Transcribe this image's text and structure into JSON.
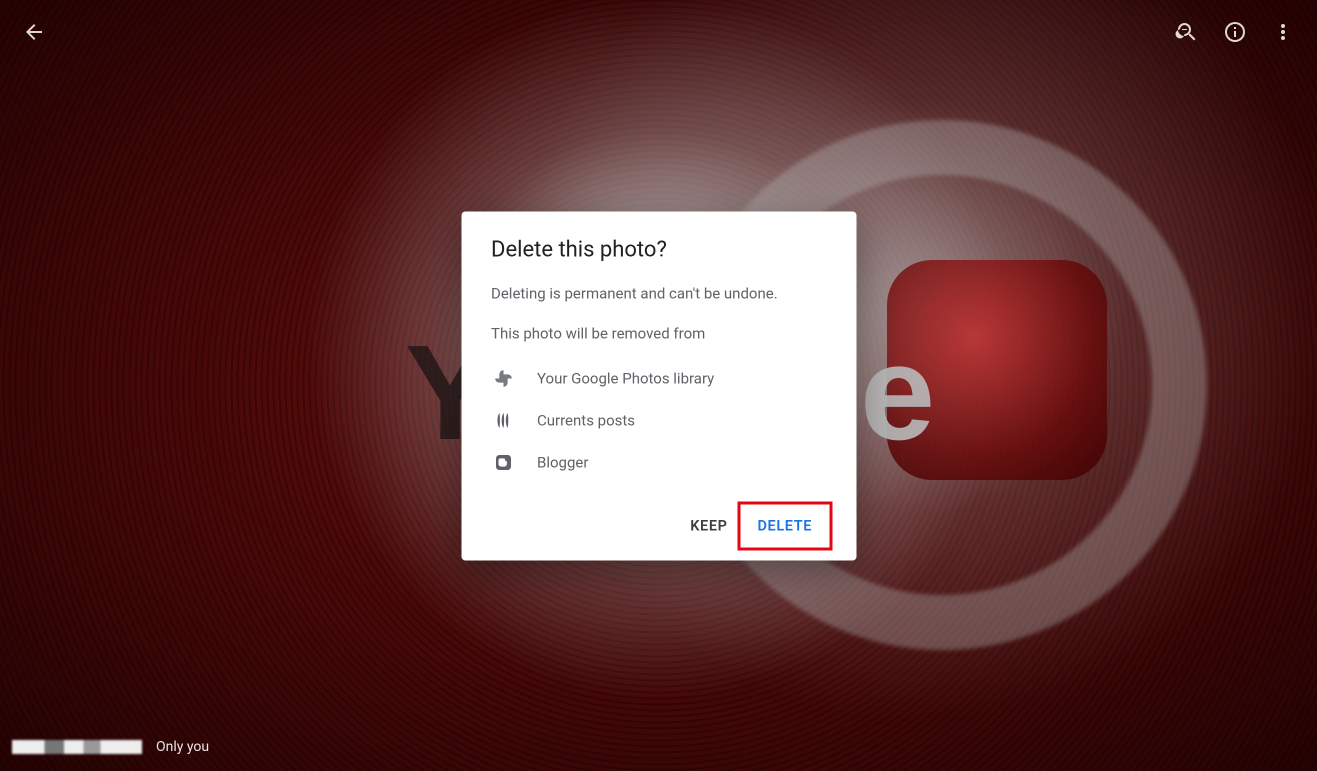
{
  "toolbar": {
    "back_label": "Back",
    "zoom_label": "Zoom",
    "info_label": "Info",
    "more_label": "More options"
  },
  "dialog": {
    "title": "Delete this photo?",
    "warning": "Deleting is permanent and can't be undone.",
    "removed_from_heading": "This photo will be removed from",
    "items": [
      {
        "icon": "google-photos-icon",
        "label": "Your Google Photos library"
      },
      {
        "icon": "currents-icon",
        "label": "Currents posts"
      },
      {
        "icon": "blogger-icon",
        "label": "Blogger"
      }
    ],
    "keep_label": "KEEP",
    "delete_label": "DELETE"
  },
  "footer": {
    "visibility": "Only you"
  },
  "background": {
    "letter_left": "Y",
    "letter_right": "e"
  }
}
